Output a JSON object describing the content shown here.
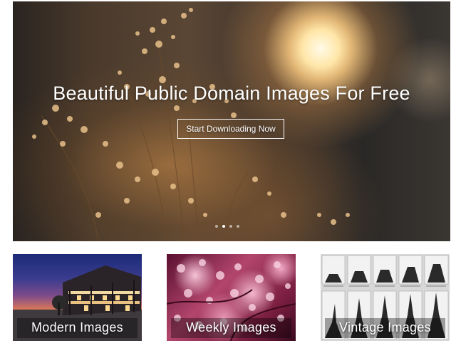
{
  "hero": {
    "title": "Beautiful Public Domain Images For Free",
    "cta_label": "Start Downloading Now",
    "slide_count": 4,
    "active_slide": 2
  },
  "categories": [
    {
      "label": "Modern Images"
    },
    {
      "label": "Weekly Images"
    },
    {
      "label": "Vintage Images"
    }
  ]
}
